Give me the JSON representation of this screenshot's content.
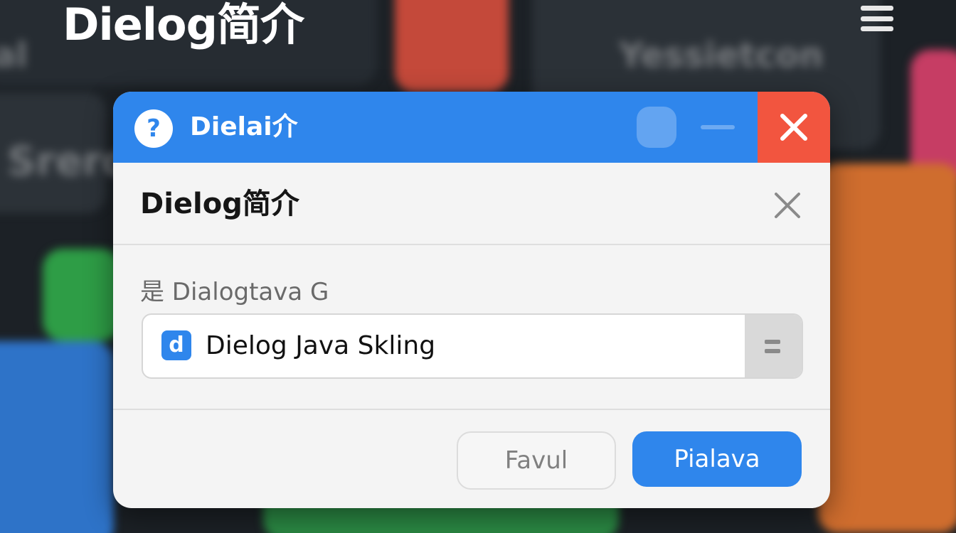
{
  "page": {
    "title": "Dielog简介"
  },
  "background": {
    "labels": [
      "Yessietcon",
      "Srero",
      "al"
    ]
  },
  "window": {
    "title": "Dielai介",
    "app_icon_glyph": "?"
  },
  "dialog": {
    "title": "Dielog简介",
    "prompt": "是 Dialogtava G",
    "select": {
      "icon_glyph": "d",
      "value": "Dielog Java Skling"
    },
    "buttons": {
      "secondary": "Favul",
      "primary": "Pialava"
    }
  },
  "colors": {
    "accent": "#2f86ec",
    "close_red": "#f2553f",
    "bg_dark": "#1c2126"
  }
}
